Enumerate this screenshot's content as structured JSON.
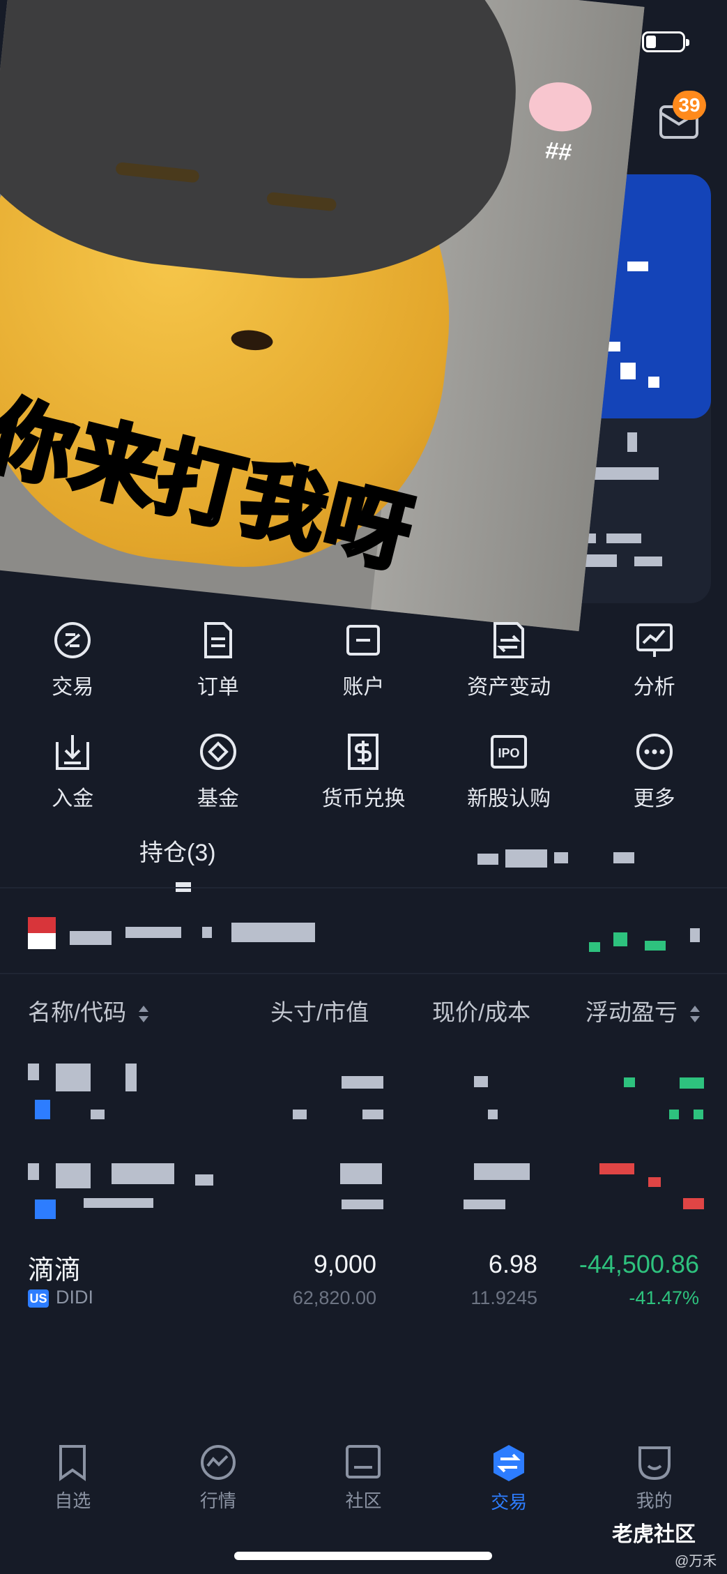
{
  "header": {
    "mail_badge": "39"
  },
  "sticker": {
    "caption": "你来打我呀",
    "pig_tag": "##"
  },
  "actions": {
    "row1": [
      {
        "label": "交易",
        "icon": "trade-icon"
      },
      {
        "label": "订单",
        "icon": "order-icon"
      },
      {
        "label": "账户",
        "icon": "account-icon"
      },
      {
        "label": "资产变动",
        "icon": "asset-change-icon"
      },
      {
        "label": "分析",
        "icon": "analysis-icon"
      }
    ],
    "row2": [
      {
        "label": "入金",
        "icon": "deposit-icon"
      },
      {
        "label": "基金",
        "icon": "fund-icon"
      },
      {
        "label": "货币兑换",
        "icon": "currency-exchange-icon"
      },
      {
        "label": "新股认购",
        "icon": "ipo-icon"
      },
      {
        "label": "更多",
        "icon": "more-icon"
      }
    ]
  },
  "tabs": {
    "positions": "持仓(3)"
  },
  "table": {
    "headers": {
      "name": "名称/代码",
      "position": "头寸/市值",
      "price": "现价/成本",
      "pnl": "浮动盈亏"
    },
    "visible_row": {
      "name": "滴滴",
      "market": "US",
      "ticker": "DIDI",
      "quantity": "9,000",
      "market_value": "62,820.00",
      "price": "6.98",
      "cost": "11.9245",
      "pnl": "-44,500.86",
      "pnl_pct": "-41.47%"
    }
  },
  "nav": [
    {
      "label": "自选",
      "icon": "watchlist-icon"
    },
    {
      "label": "行情",
      "icon": "market-icon"
    },
    {
      "label": "社区",
      "icon": "community-icon"
    },
    {
      "label": "交易",
      "icon": "trade-nav-icon",
      "active": true
    },
    {
      "label": "我的",
      "icon": "profile-icon"
    }
  ],
  "watermark": {
    "brand": "老虎社区",
    "author": "@万禾"
  },
  "colors": {
    "background": "#161b27",
    "accent": "#2d7dff",
    "gain_text": "#2ec27e",
    "badge": "#ff8a1c"
  }
}
